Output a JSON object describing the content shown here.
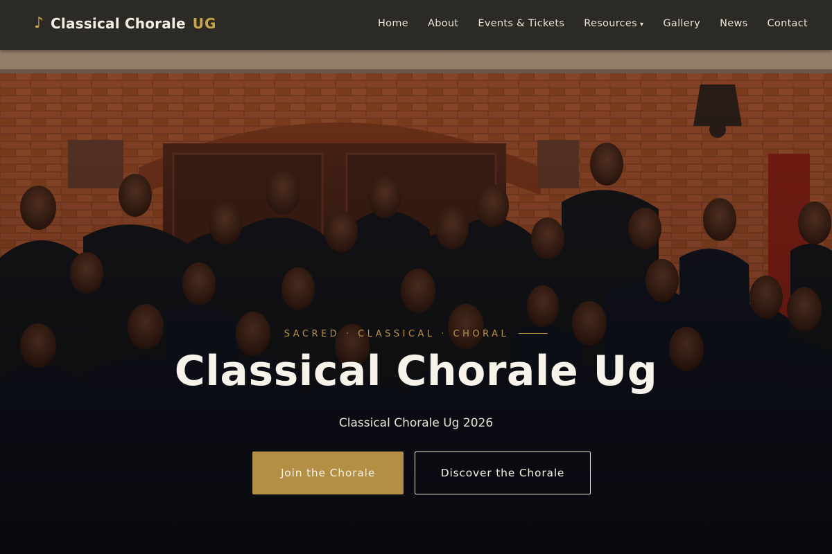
{
  "brand": {
    "icon": "music-note-icon",
    "glyph": "♪",
    "name": "Classical Chorale",
    "suffix": "UG"
  },
  "nav": {
    "items": [
      {
        "label": "Home"
      },
      {
        "label": "About"
      },
      {
        "label": "Events & Tickets"
      },
      {
        "label": "Resources",
        "caret": "▾"
      },
      {
        "label": "Gallery"
      },
      {
        "label": "News"
      },
      {
        "label": "Contact"
      }
    ]
  },
  "hero": {
    "eyebrow": "SACRED · CLASSICAL · CHORAL",
    "title": "Classical Chorale Ug",
    "subtitle": "Classical Chorale Ug 2026",
    "primary_cta": "Join the Chorale",
    "secondary_cta": "Discover the Chorale"
  },
  "colors": {
    "nav_bg": "#2b2a24",
    "accent_gold": "#b28f45",
    "text_light": "#f7f3ea"
  }
}
